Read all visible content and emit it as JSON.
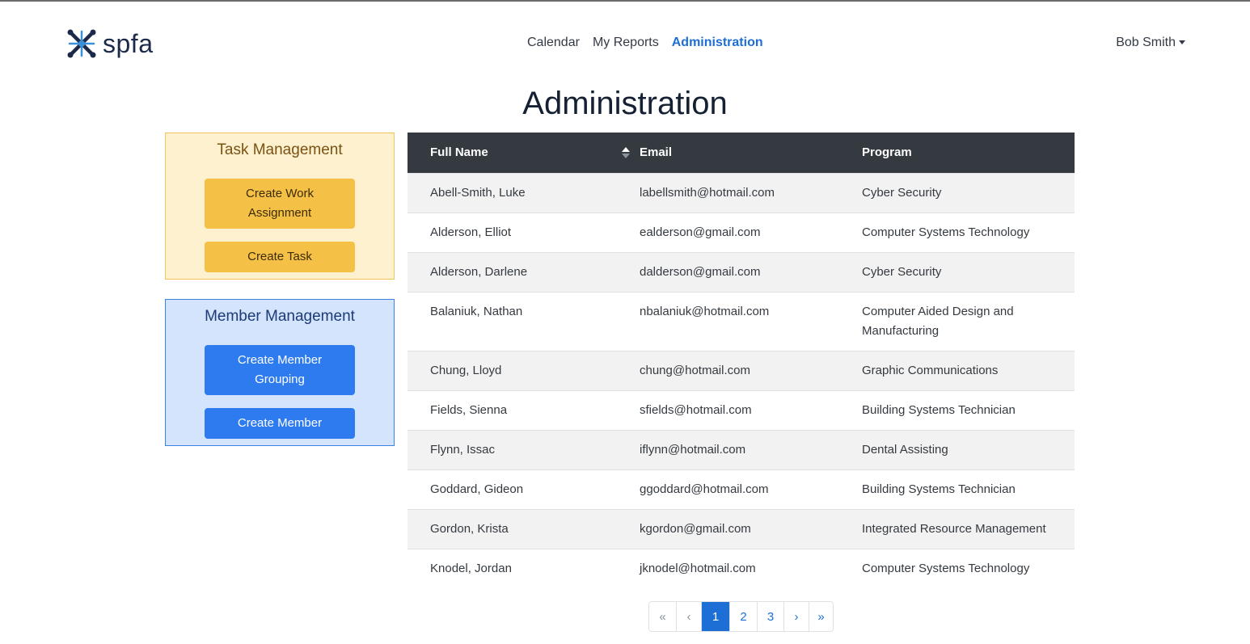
{
  "brand": {
    "name": "spfa"
  },
  "nav": {
    "links": [
      {
        "label": "Calendar"
      },
      {
        "label": "My Reports"
      },
      {
        "label": "Administration"
      }
    ],
    "user": "Bob Smith"
  },
  "page": {
    "title": "Administration"
  },
  "sidebar": {
    "task_management": {
      "title": "Task Management",
      "create_work_assignment": "Create Work Assignment",
      "create_task": "Create Task"
    },
    "member_management": {
      "title": "Member Management",
      "create_member_grouping": "Create Member Grouping",
      "create_member": "Create Member"
    }
  },
  "table": {
    "columns": {
      "full_name": "Full Name",
      "email": "Email",
      "program": "Program"
    },
    "rows": [
      {
        "name": "Abell-Smith, Luke",
        "email": "labellsmith@hotmail.com",
        "program": "Cyber Security"
      },
      {
        "name": "Alderson, Elliot",
        "email": "ealderson@gmail.com",
        "program": "Computer Systems Technology"
      },
      {
        "name": "Alderson, Darlene",
        "email": "dalderson@gmail.com",
        "program": "Cyber Security"
      },
      {
        "name": "Balaniuk, Nathan",
        "email": "nbalaniuk@hotmail.com",
        "program": "Computer Aided Design and Manufacturing"
      },
      {
        "name": "Chung, Lloyd",
        "email": "chung@hotmail.com",
        "program": "Graphic Communications"
      },
      {
        "name": "Fields, Sienna",
        "email": "sfields@hotmail.com",
        "program": "Building Systems Technician"
      },
      {
        "name": "Flynn, Issac",
        "email": "iflynn@hotmail.com",
        "program": "Dental Assisting"
      },
      {
        "name": "Goddard, Gideon",
        "email": "ggoddard@hotmail.com",
        "program": "Building Systems Technician"
      },
      {
        "name": "Gordon, Krista",
        "email": "kgordon@gmail.com",
        "program": "Integrated Resource Management"
      },
      {
        "name": "Knodel, Jordan",
        "email": "jknodel@hotmail.com",
        "program": "Computer Systems Technology"
      }
    ]
  },
  "pagination": {
    "first": "«",
    "prev": "‹",
    "pages": [
      "1",
      "2",
      "3"
    ],
    "current": "1",
    "next": "›",
    "last": "»"
  },
  "colors": {
    "accent": "#1d6fd6",
    "header_dark": "#343a40",
    "task_bg": "#fdf1cf",
    "task_button": "#f5c046",
    "member_bg": "#d3e4fc",
    "member_button": "#2e7bf0"
  }
}
